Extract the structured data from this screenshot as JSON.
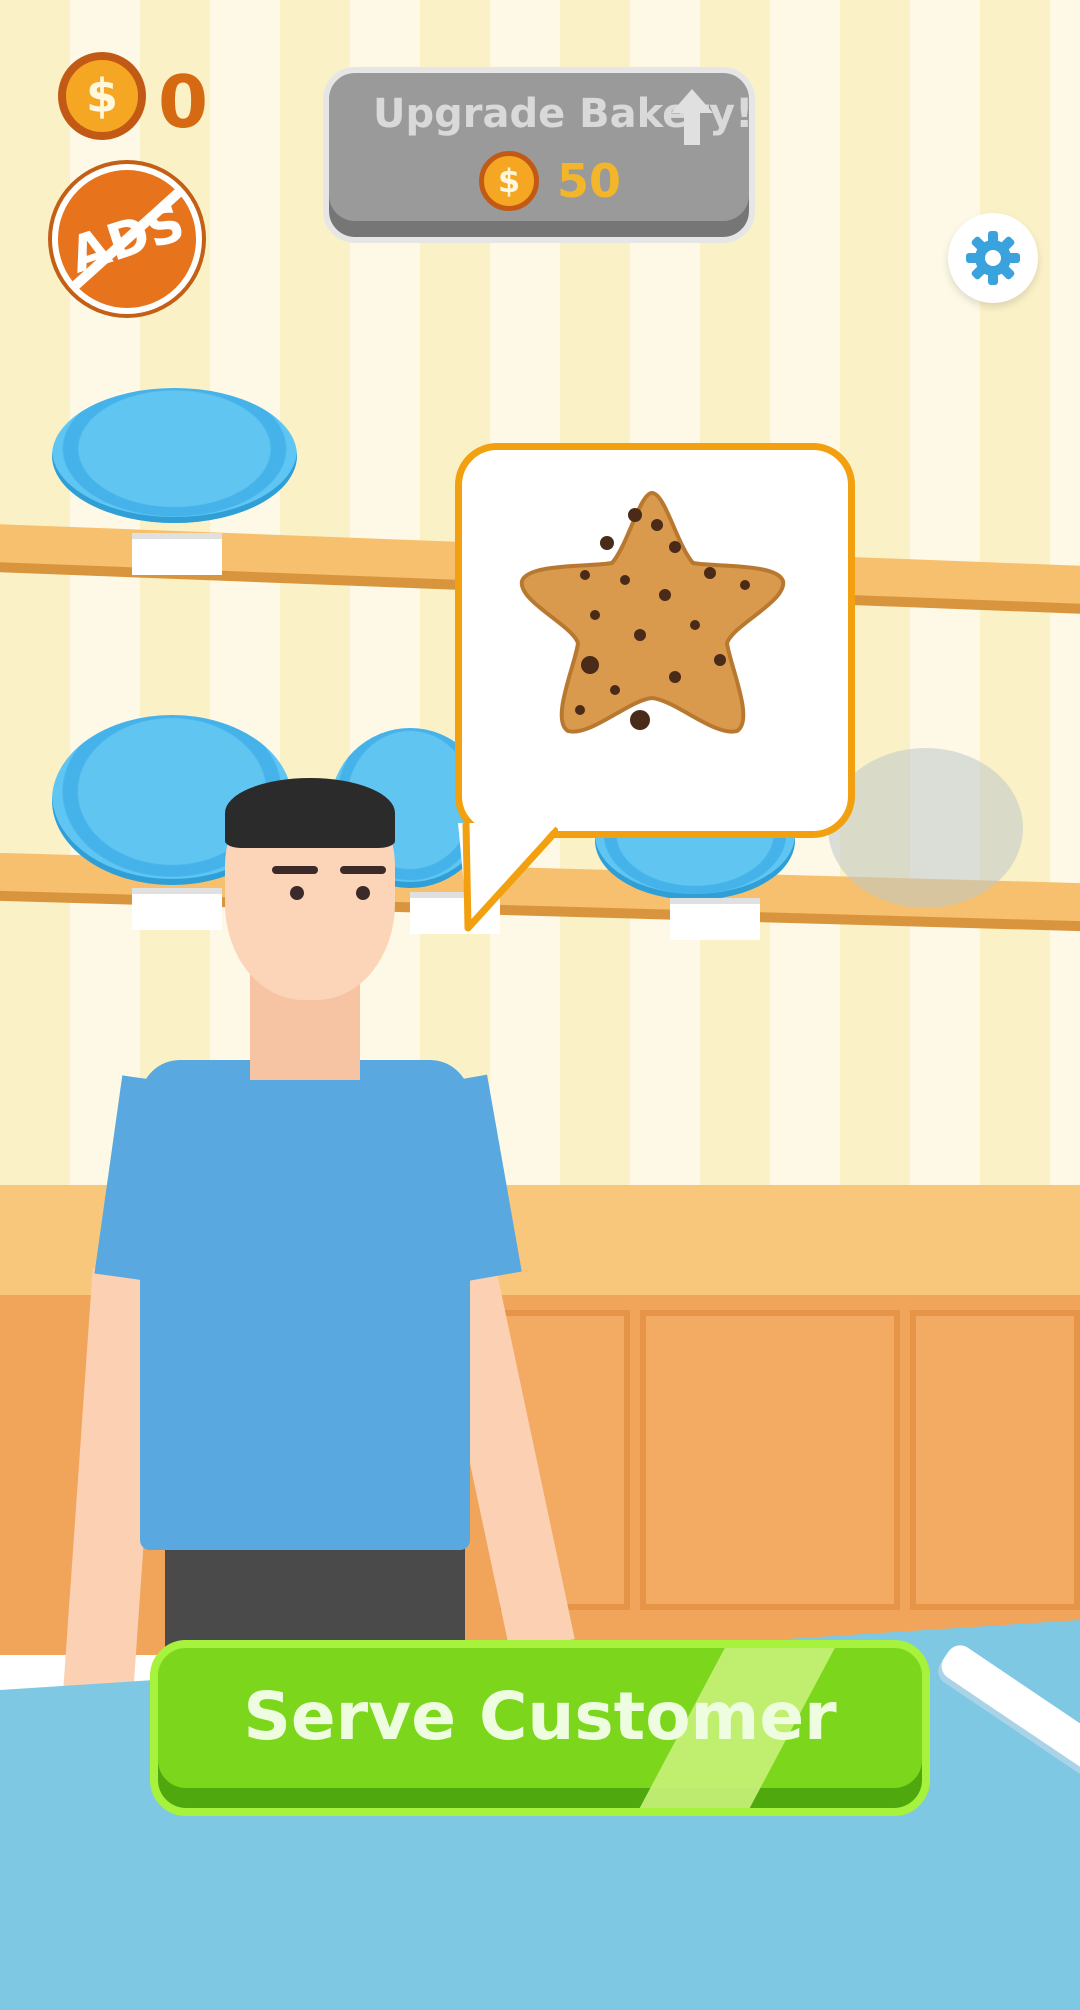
{
  "hud": {
    "coin_icon": "dollar-coin-icon",
    "coin_symbol": "$",
    "coin_count": "0",
    "no_ads_label": "ADS",
    "settings_icon": "gear-icon"
  },
  "upgrade": {
    "title": "Upgrade Bakery!",
    "arrow_icon": "up-arrow-icon",
    "price_symbol": "$",
    "price": "50"
  },
  "order": {
    "item_icon": "star-chocolate-chip-cookie"
  },
  "serve_button": {
    "label": "Serve Customer"
  },
  "colors": {
    "coin_fill": "#f5a623",
    "coin_border": "#c25a16",
    "serve_green": "#7bd61c",
    "bubble_border": "#f2a010",
    "plate_blue": "#61c5f2",
    "settings_gear": "#3aa3dd"
  }
}
